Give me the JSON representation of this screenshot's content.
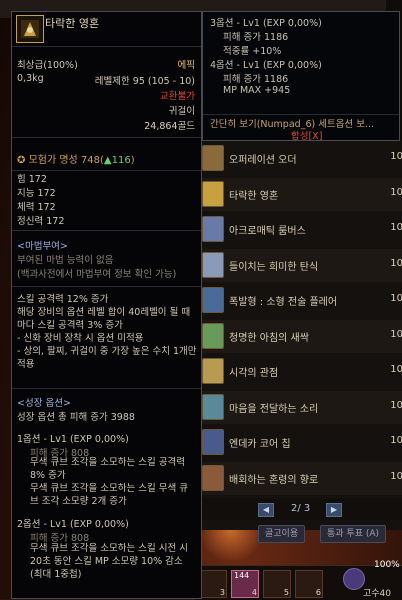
{
  "tooltip": {
    "item_name": "타락한 영혼",
    "grade": "최상급(100%)",
    "rarity": "에픽",
    "weight": "0,3kg",
    "level_limit": "레벨제한 95 (105 - 10)",
    "trade": "교환불가",
    "slot": "귀걸이",
    "price": "24,864골드",
    "fame_label": "모험가 명성 748(",
    "fame_up": "▲116",
    "fame_close": ")",
    "stats": [
      "힘 172",
      "지능 172",
      "체력 172",
      "정신력 172"
    ],
    "magic_header": "<마법부여>",
    "magic_lines": [
      "부여된 마법 능력이 없음",
      "(백과사전에서 마법부여 정보 확인 가능)"
    ],
    "skill_text": "스킬 공격력 12% 증가\n해당 장비의 옵션 레벨 합이 40레벨이 될 때마다 스킬 공격력 3% 증가\n- 신화 장비 장착 시 옵션 미적용\n- 상의, 팔찌, 귀걸이 중 가장 높은 수치 1개만 적용",
    "growth_header": "<성장 옵션>",
    "growth_total": "성장 옵션 총 피해 증가 3988",
    "option1_title": "1옵션 - Lv1 (EXP 0,00%)",
    "option1_dmg": "피해 증가 808",
    "option1_lines": "무색 큐브 조각을 소모하는 스킬 공격력 8% 증가\n무색 큐브 조각을 소모하는 스킬 무색 큐브 조각 소모량 2개 증가",
    "option2_title": "2옵션 - Lv1 (EXP 0,00%)",
    "option2_dmg": "피해 증가 808",
    "option2_lines": "무색 큐브 조각을 소모하는 스킬 시전 시 20초 동안 스킬 MP 소모량 10% 감소 (최대 1중첩)"
  },
  "tooltip2": {
    "opt3_title": "3옵션 - Lv1 (EXP 0,00%)",
    "opt3_dmg": "피해 증가 1186",
    "opt3_line": "적중률 +10%",
    "opt4_title": "4옵션 - Lv1 (EXP 0,00%)",
    "opt4_dmg": "피해 증가 1186",
    "opt4_line": "MP MAX +945",
    "set_link": "간단히 보기(Numpad_6) 세트옵션 보...",
    "synthesis": "합성[X]"
  },
  "item_list": {
    "rows": [
      {
        "name": "오퍼레이션 오더",
        "num": "10"
      },
      {
        "name": "타락한 영혼",
        "num": "10"
      },
      {
        "name": "아크로매틱 룸버스",
        "num": "10"
      },
      {
        "name": "들이치는 희미한 탄식",
        "num": "10"
      },
      {
        "name": "폭발형 : 소형 전술 플레어",
        "num": "10"
      },
      {
        "name": "청명한 아침의 새싹",
        "num": "10"
      },
      {
        "name": "시각의 관점",
        "num": "10"
      },
      {
        "name": "마음을 전달하는 소리",
        "num": "10"
      },
      {
        "name": "엔데카 코어 칩",
        "num": "10"
      },
      {
        "name": "배회하는 혼령의 향로",
        "num": "10"
      }
    ],
    "page": "2/ 3",
    "prev_btn": "◀",
    "next_btn": "▶",
    "tab_left": "골고이용",
    "tab_right": "통과 투표 (A)"
  },
  "hotbar": {
    "slot_count": "14",
    "slot4_count": "144",
    "percent": "100%",
    "grade": "고수40",
    "slot_keys": [
      "3",
      "4",
      "5",
      "6"
    ]
  },
  "colors": {
    "tooltip_bg": "#050507",
    "epic": "#e8c060",
    "untradeable": "#e04a2a",
    "fame_up": "#6ad06a",
    "magic": "#9ab4e0"
  }
}
